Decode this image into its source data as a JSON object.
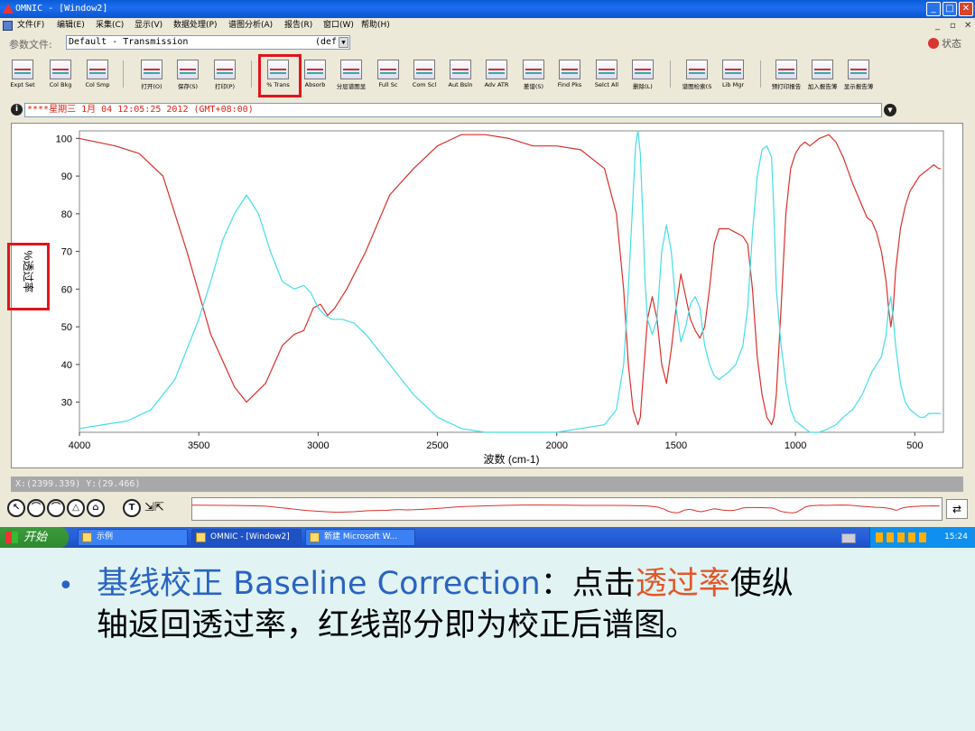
{
  "window": {
    "title": "OMNIC - [Window2]",
    "min": "_",
    "max": "□",
    "close": "✕"
  },
  "menu": [
    "文件(F)",
    "编辑(E)",
    "采集(C)",
    "显示(V)",
    "数据处理(P)",
    "谱图分析(A)",
    "报告(R)",
    "窗口(W)",
    "帮助(H)"
  ],
  "mdi_controls": [
    "_",
    "▫",
    "✕"
  ],
  "params": {
    "label": "参数文件:",
    "value": "Default - Transmission",
    "def": "(def",
    "dropdown": "▼",
    "status": "状态"
  },
  "toolbar": [
    {
      "label": "Expt Set"
    },
    {
      "label": "Col Bkg"
    },
    {
      "label": "Col Smp"
    },
    {
      "label": "打开(O)"
    },
    {
      "label": "保存(S)"
    },
    {
      "label": "打印(P)"
    },
    {
      "label": "% Trans"
    },
    {
      "label": "Absorb"
    },
    {
      "label": "分层谱图显"
    },
    {
      "label": "Full Sc"
    },
    {
      "label": "Com Scl"
    },
    {
      "label": "Aut Bsln"
    },
    {
      "label": "Adv ATR"
    },
    {
      "label": "差谱(S)"
    },
    {
      "label": "Find Pks"
    },
    {
      "label": "Selct All"
    },
    {
      "label": "删除(L)"
    },
    {
      "label": "谱图检索(S"
    },
    {
      "label": "Lib Mgr"
    },
    {
      "label": "预打印报告"
    },
    {
      "label": "加入报告薄"
    },
    {
      "label": "显示报告薄"
    }
  ],
  "comment": "****星期三 1月 04 12:05:25 2012 (GMT+08:00)",
  "chart_data": {
    "type": "line",
    "xlabel": "波数 (cm-1)",
    "ylabel": "%透过率",
    "xlim": [
      4000,
      380
    ],
    "ylim": [
      22,
      102
    ],
    "x_ticks": [
      4000,
      3500,
      3000,
      2500,
      2000,
      1500,
      1000,
      500
    ],
    "y_ticks": [
      100,
      90,
      80,
      70,
      60,
      50,
      40,
      30
    ],
    "series": [
      {
        "color": "#d8302a",
        "x": [
          4000,
          3850,
          3750,
          3650,
          3550,
          3450,
          3350,
          3300,
          3220,
          3150,
          3100,
          3060,
          3020,
          2990,
          2960,
          2930,
          2880,
          2800,
          2700,
          2600,
          2500,
          2400,
          2300,
          2200,
          2100,
          2000,
          1900,
          1800,
          1750,
          1720,
          1700,
          1680,
          1660,
          1650,
          1640,
          1620,
          1600,
          1580,
          1560,
          1540,
          1520,
          1500,
          1480,
          1460,
          1440,
          1420,
          1400,
          1380,
          1360,
          1340,
          1320,
          1300,
          1280,
          1250,
          1220,
          1200,
          1180,
          1160,
          1140,
          1120,
          1100,
          1090,
          1080,
          1060,
          1040,
          1020,
          1000,
          980,
          960,
          940,
          900,
          860,
          830,
          800,
          760,
          720,
          700,
          680,
          660,
          640,
          620,
          610,
          600,
          590,
          580,
          560,
          540,
          520,
          500,
          480,
          460,
          440,
          420,
          400,
          390
        ],
        "y": [
          100,
          98,
          96,
          90,
          70,
          48,
          34,
          30,
          35,
          45,
          48,
          49,
          55,
          56,
          53,
          55,
          60,
          70,
          85,
          92,
          98,
          101,
          101,
          100,
          98,
          98,
          97,
          92,
          80,
          60,
          40,
          28,
          24,
          26,
          35,
          52,
          58,
          52,
          40,
          35,
          44,
          55,
          64,
          58,
          52,
          49,
          47,
          50,
          60,
          72,
          76,
          76,
          76,
          75,
          74,
          72,
          60,
          42,
          32,
          26,
          24,
          26,
          32,
          55,
          80,
          92,
          96,
          98,
          99,
          98,
          100,
          101,
          99,
          95,
          88,
          82,
          79,
          78,
          75,
          70,
          62,
          55,
          50,
          55,
          65,
          76,
          82,
          86,
          88,
          90,
          91,
          92,
          93,
          92,
          92
        ]
      },
      {
        "color": "#45dde6",
        "x": [
          4000,
          3900,
          3800,
          3700,
          3600,
          3500,
          3450,
          3400,
          3350,
          3300,
          3250,
          3200,
          3150,
          3100,
          3060,
          3030,
          3000,
          2970,
          2940,
          2900,
          2850,
          2800,
          2700,
          2600,
          2500,
          2400,
          2300,
          2200,
          2100,
          2000,
          1900,
          1800,
          1750,
          1720,
          1700,
          1680,
          1670,
          1660,
          1650,
          1640,
          1630,
          1620,
          1600,
          1580,
          1560,
          1540,
          1520,
          1500,
          1480,
          1460,
          1440,
          1420,
          1400,
          1380,
          1360,
          1340,
          1320,
          1300,
          1280,
          1250,
          1220,
          1200,
          1180,
          1160,
          1140,
          1120,
          1100,
          1090,
          1080,
          1060,
          1040,
          1020,
          1000,
          980,
          960,
          940,
          900,
          860,
          830,
          800,
          760,
          720,
          700,
          680,
          660,
          640,
          620,
          610,
          600,
          590,
          580,
          560,
          540,
          520,
          500,
          480,
          460,
          440,
          420,
          400,
          390
        ],
        "y": [
          23,
          24,
          25,
          28,
          36,
          52,
          62,
          73,
          80,
          85,
          80,
          70,
          62,
          60,
          61,
          59,
          55,
          53,
          52,
          52,
          51,
          48,
          40,
          32,
          26,
          23,
          22,
          22,
          22,
          22,
          23,
          24,
          28,
          40,
          60,
          85,
          98,
          102,
          96,
          80,
          62,
          52,
          48,
          52,
          70,
          77,
          70,
          55,
          46,
          50,
          56,
          58,
          55,
          45,
          40,
          37,
          36,
          37,
          38,
          40,
          45,
          55,
          75,
          90,
          97,
          98,
          95,
          80,
          60,
          45,
          35,
          28,
          25,
          24,
          23,
          22,
          22,
          23,
          24,
          26,
          28,
          32,
          35,
          38,
          40,
          42,
          48,
          55,
          58,
          52,
          45,
          35,
          30,
          28,
          27,
          26,
          26,
          27,
          27,
          27,
          27
        ]
      }
    ]
  },
  "coords": "X:(2399.339) Y:(29.466)",
  "nav": {
    "buttons": [
      "↖",
      "⌒",
      "⌒",
      "△",
      "⌂",
      "T"
    ],
    "right": "⇄"
  },
  "taskbar": {
    "start": "开始",
    "tasks": [
      "示例",
      "OMNIC - [Window2]",
      "新建 Microsoft W..."
    ],
    "clock": "15:24"
  },
  "caption": {
    "bullet": "•",
    "blue_text": "基线校正 Baseline Correction",
    "sep": "：点击",
    "highlight": "透过率",
    "rest1": "使纵",
    "line2": "轴返回透过率，红线部分即为校正后谱图。"
  }
}
